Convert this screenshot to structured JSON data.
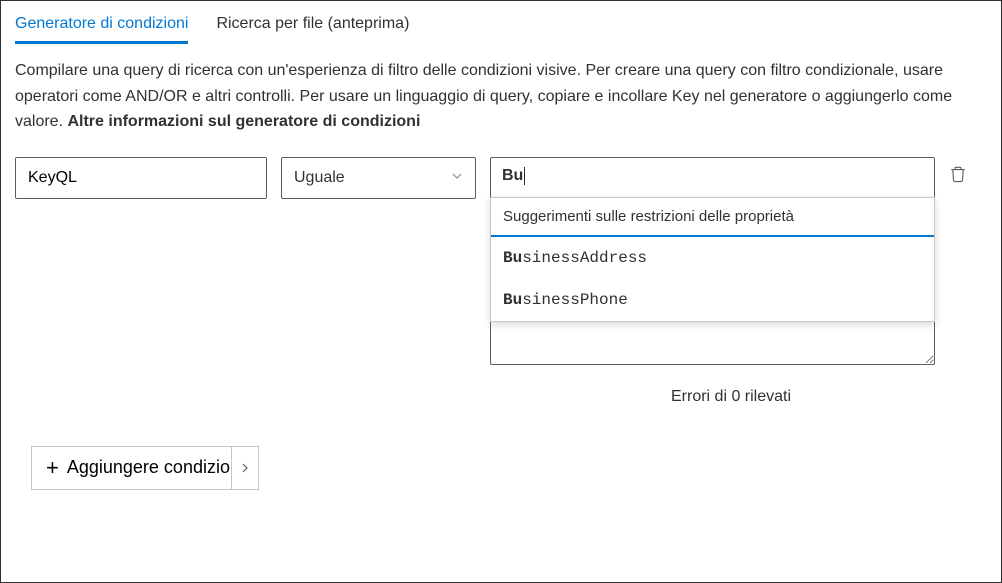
{
  "tabs": {
    "conditions": "Generatore di condizioni",
    "file_search": "Ricerca per file (anteprima)"
  },
  "description": {
    "text": "Compilare una query di ricerca con un'esperienza di filtro delle condizioni visive. Per creare una query con filtro condizionale, usare operatori come AND/OR e altri controlli. Per usare un linguaggio di query, copiare e incollare Key nel generatore o aggiungerlo come valore. ",
    "link": "Altre informazioni sul generatore di condizioni"
  },
  "condition": {
    "field": "KeyQL",
    "operator": "Uguale",
    "typed_value": "Bu"
  },
  "suggestions": {
    "header": "Suggerimenti sulle restrizioni delle proprietà",
    "items": [
      {
        "prefix": "Bu",
        "rest": "sinessAddress"
      },
      {
        "prefix": "Bu",
        "rest": "sinessPhone"
      }
    ]
  },
  "errors": "Errori di 0 rilevati",
  "add_button": "Aggiungere condizioni"
}
